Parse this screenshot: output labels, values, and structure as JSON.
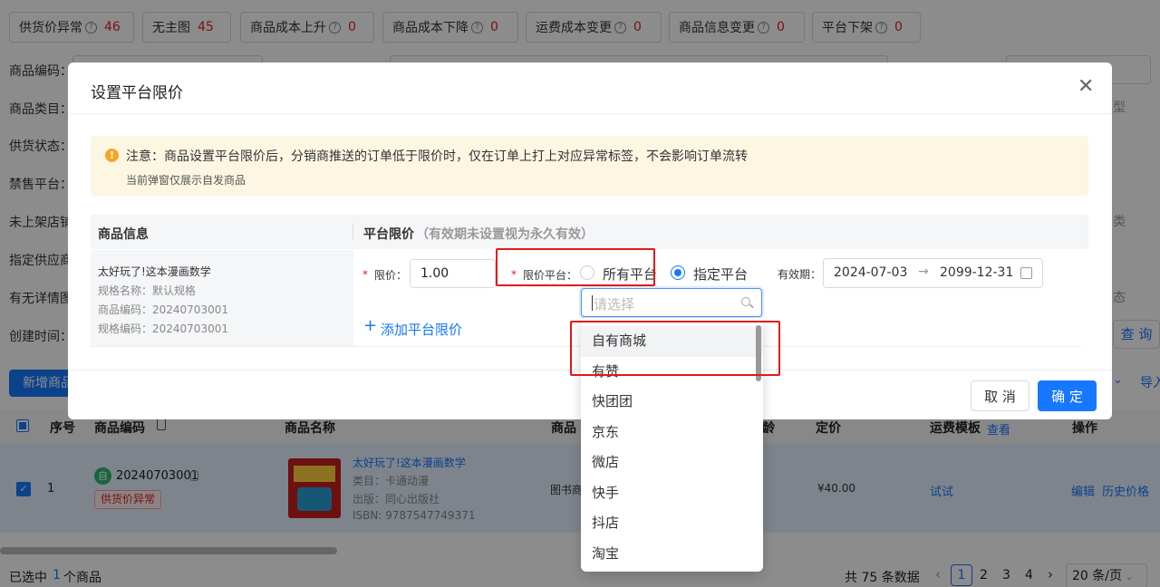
{
  "tabs": [
    {
      "label": "供货价异常",
      "count": "46",
      "help": true
    },
    {
      "label": "无主图",
      "count": "45",
      "help": false
    },
    {
      "label": "商品成本上升",
      "count": "0",
      "help": true
    },
    {
      "label": "商品成本下降",
      "count": "0",
      "help": true
    },
    {
      "label": "运费成本变更",
      "count": "0",
      "help": true
    },
    {
      "label": "商品信息变更",
      "count": "0",
      "help": true
    },
    {
      "label": "平台下架",
      "count": "0",
      "help": true
    }
  ],
  "filters": [
    "商品编码：",
    "商品类目：",
    "供货状态：",
    "禁售平台：",
    "未上架店铺",
    "指定供应商",
    "有无详情图",
    "创建时间："
  ],
  "filter_right": {
    "type_hint": "型",
    "class_hint": "类",
    "state_hint": "态",
    "query": "查 询"
  },
  "toolbar": {
    "add_product": "新增商品",
    "import": "导入"
  },
  "table": {
    "headers": {
      "seq": "序号",
      "code": "商品编码",
      "name": "商品名称",
      "col4": "商品",
      "col5": "龄",
      "price": "定价",
      "freight": "运费模板",
      "freight_view": "查看",
      "action": "操作"
    },
    "row": {
      "seq": "1",
      "self_tag": "自",
      "code": "20240703001",
      "badge": "供货价异常",
      "title": "太好玩了!这本漫画数学",
      "category": "类目：卡通动漫",
      "publisher": "出版：同心出版社",
      "isbn": "ISBN: 9787547749371",
      "col4": "图书商",
      "price": "¥40.00",
      "freight": "试试",
      "edit": "编辑",
      "history": "历史价格"
    }
  },
  "footer": {
    "selected_prefix": "已选中",
    "selected_count": "1",
    "selected_suffix": "个商品",
    "total": "共 75 条数据",
    "pages": [
      "1",
      "2",
      "3",
      "4"
    ],
    "page_size": "20 条/页"
  },
  "modal": {
    "title": "设置平台限价",
    "notice": "注意：商品设置平台限价后，分销商推送的订单低于限价时，仅在订单上打上对应异常标签，不会影响订单流转",
    "notice_sub": "当前弹窗仅展示自发商品",
    "col_info": "商品信息",
    "col_limit": "平台限价",
    "col_limit_hint": "（有效期未设置视为永久有效）",
    "product": {
      "name": "太好玩了!这本漫画数学",
      "spec": "规格名称：默认规格",
      "code": "商品编码：20240703001",
      "spec_code": "规格编码：20240703001"
    },
    "price_label": "限价：",
    "price_value": "1.00",
    "platform_label": "限价平台：",
    "opt_all": "所有平台",
    "opt_specific": "指定平台",
    "validity_label": "有效期：",
    "date_start": "2024-07-03",
    "date_end": "2099-12-31",
    "add_limit": "添加平台限价",
    "cancel": "取 消",
    "ok": "确 定"
  },
  "dropdown": {
    "placeholder": "请选择",
    "options": [
      "自有商城",
      "有赞",
      "快团团",
      "京东",
      "微店",
      "快手",
      "抖店",
      "淘宝"
    ]
  },
  "colors": {
    "primary": "#1677ff",
    "danger": "#e02020",
    "highlight": "#e21818"
  }
}
